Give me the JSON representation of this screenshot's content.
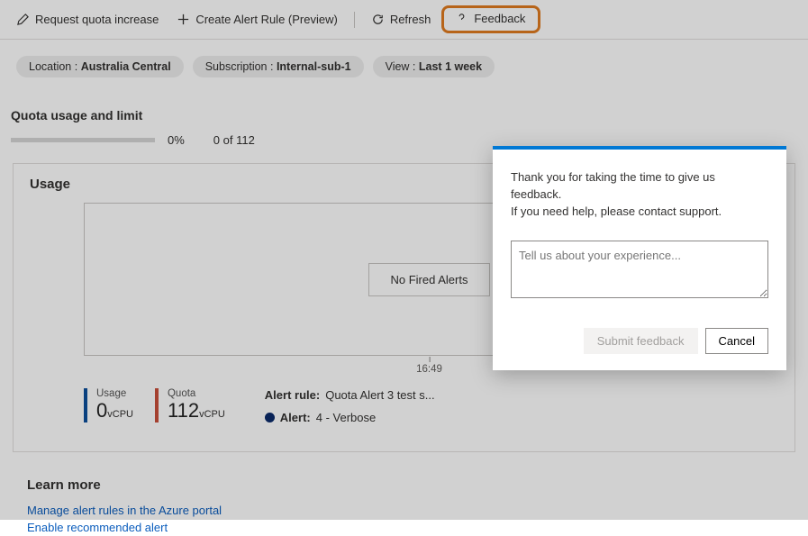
{
  "toolbar": {
    "request_quota": "Request quota increase",
    "create_alert": "Create Alert Rule (Preview)",
    "refresh": "Refresh",
    "feedback": "Feedback"
  },
  "filters": {
    "location_label": "Location : ",
    "location_value": "Australia Central",
    "subscription_label": "Subscription : ",
    "subscription_value": "Internal-sub-1",
    "view_label": "View : ",
    "view_value": "Last 1 week"
  },
  "quota_section": {
    "title": "Quota usage and limit",
    "percent": "0%",
    "count": "0 of 112"
  },
  "usage_card": {
    "title": "Usage",
    "no_alerts": "No Fired Alerts",
    "axis_time": "16:49",
    "usage_label": "Usage",
    "usage_value": "0",
    "usage_unit": "vCPU",
    "quota_label": "Quota",
    "quota_value": "112",
    "quota_unit": "vCPU",
    "alert_rule_label": "Alert rule:",
    "alert_rule_value": " Quota Alert 3 test s...",
    "alert_label": "Alert:",
    "alert_value": " 4 - Verbose"
  },
  "learn_more": {
    "title": "Learn more",
    "link1": "Manage alert rules in the Azure portal",
    "link2": "Enable recommended alert"
  },
  "feedback_panel": {
    "line1": "Thank you for taking the time to give us feedback.",
    "line2": "If you need help, please contact support.",
    "placeholder": "Tell us about your experience...",
    "submit": "Submit feedback",
    "cancel": "Cancel"
  }
}
